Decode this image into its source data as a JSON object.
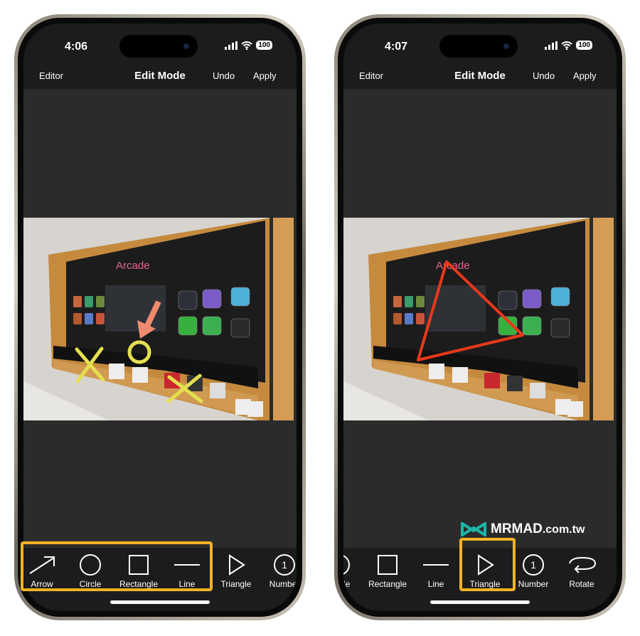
{
  "phones": [
    {
      "time": "4:06",
      "battery": "100",
      "nav": {
        "left": "Editor",
        "title": "Edit Mode",
        "undo": "Undo",
        "apply": "Apply"
      },
      "photo_sign": "Arcade",
      "tools": [
        {
          "label": "Arrow",
          "icon": "arrow-icon"
        },
        {
          "label": "Circle",
          "icon": "circle-icon"
        },
        {
          "label": "Rectangle",
          "icon": "rectangle-icon"
        },
        {
          "label": "Line",
          "icon": "line-icon"
        },
        {
          "label": "Triangle",
          "icon": "triangle-icon"
        },
        {
          "label": "Number",
          "icon": "number-icon"
        }
      ],
      "annotations": [
        "yellow X marks",
        "yellow circle",
        "orange arrow"
      ]
    },
    {
      "time": "4:07",
      "battery": "100",
      "nav": {
        "left": "Editor",
        "title": "Edit Mode",
        "undo": "Undo",
        "apply": "Apply"
      },
      "photo_sign": "Arcade",
      "selected_tool": "Triangle",
      "tools": [
        {
          "label": "Circle",
          "icon": "circle-icon"
        },
        {
          "label": "Rectangle",
          "icon": "rectangle-icon"
        },
        {
          "label": "Line",
          "icon": "line-icon"
        },
        {
          "label": "Triangle",
          "icon": "triangle-icon"
        },
        {
          "label": "Number",
          "icon": "number-icon"
        },
        {
          "label": "Rotate",
          "icon": "rotate-icon"
        }
      ],
      "number_glyph": "1"
    }
  ],
  "watermark": {
    "brand": "MRMAD",
    "domain": ".com.tw"
  },
  "colors": {
    "highlight": "#f5b324",
    "yellow_mark": "#e4e050",
    "arrow": "#f08a6e",
    "triangle": "#e8391b"
  }
}
